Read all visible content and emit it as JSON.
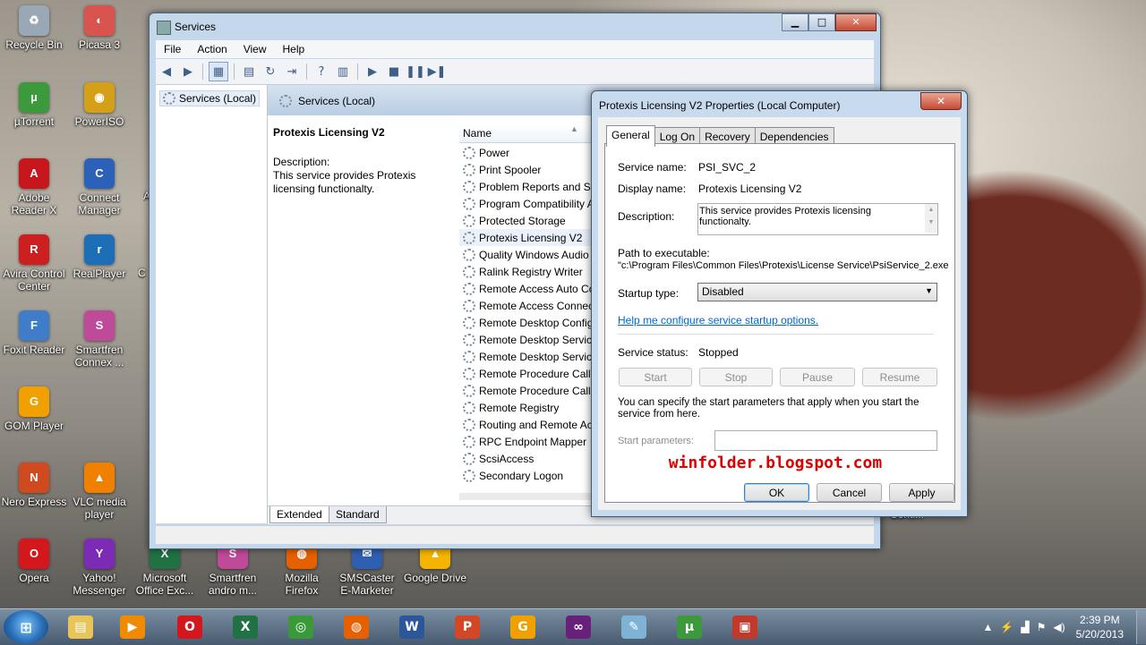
{
  "desktop": {
    "icons": [
      {
        "label": "Recycle Bin",
        "icon": "recycle-bin-icon",
        "color": "#9aa7b5",
        "glyph": "♻"
      },
      {
        "label": "Picasa 3",
        "icon": "picasa-icon",
        "color": "#d9534f",
        "glyph": "◐"
      },
      {
        "label": "µTorrent",
        "icon": "utorrent-icon",
        "color": "#3c9a3c",
        "glyph": "µ"
      },
      {
        "label": "PowerISO",
        "icon": "poweriso-icon",
        "color": "#d4a017",
        "glyph": "◉"
      },
      {
        "label": "Adobe Reader X",
        "icon": "adobe-reader-icon",
        "color": "#c8161d",
        "glyph": "A"
      },
      {
        "label": "Connect Manager",
        "icon": "connect-manager-icon",
        "color": "#2b61b8",
        "glyph": "C"
      },
      {
        "label": "Avira Control Center",
        "icon": "avira-icon",
        "color": "#cc1f1f",
        "glyph": "R"
      },
      {
        "label": "RealPlayer",
        "icon": "realplayer-icon",
        "color": "#1c6fb7",
        "glyph": "r"
      },
      {
        "label": "Foxit Reader",
        "icon": "foxit-reader-icon",
        "color": "#3f7dc8",
        "glyph": "F"
      },
      {
        "label": "Smartfren Connex ...",
        "icon": "smartfren-connex-icon",
        "color": "#c04a9a",
        "glyph": "S"
      },
      {
        "label": "GOM Player",
        "icon": "gom-player-icon",
        "color": "#f0a000",
        "glyph": "G"
      },
      {
        "label": "Nero Express",
        "icon": "nero-express-icon",
        "color": "#d04a20",
        "glyph": "N"
      },
      {
        "label": "VLC media player",
        "icon": "vlc-icon",
        "color": "#f08000",
        "glyph": "▲"
      },
      {
        "label": "Opera",
        "icon": "opera-icon",
        "color": "#d4161d",
        "glyph": "O"
      },
      {
        "label": "Yahoo! Messenger",
        "icon": "yahoo-messenger-icon",
        "color": "#7b2bb5",
        "glyph": "Y"
      },
      {
        "label": "Microsoft Office Exc...",
        "icon": "excel-shortcut-icon",
        "color": "#207245",
        "glyph": "X"
      },
      {
        "label": "Smartfren andro m...",
        "icon": "smartfren-andro-icon",
        "color": "#c04a9a",
        "glyph": "S"
      },
      {
        "label": "Mozilla Firefox",
        "icon": "firefox-icon",
        "color": "#e66000",
        "glyph": "◍"
      },
      {
        "label": "SMSCaster E-Marketer",
        "icon": "smscaster-icon",
        "color": "#2f5fb0",
        "glyph": "✉"
      },
      {
        "label": "Google Drive",
        "icon": "google-drive-icon",
        "color": "#f4b400",
        "glyph": "▲"
      }
    ],
    "partial_labels": [
      "C",
      "A",
      "Conti..."
    ]
  },
  "services_window": {
    "title": "Services",
    "menu": [
      "File",
      "Action",
      "View",
      "Help"
    ],
    "tree_item": "Services (Local)",
    "header_label": "Services (Local)",
    "selected_service_title": "Protexis Licensing V2",
    "description_label": "Description:",
    "description_text": "This service provides Protexis licensing functionalty.",
    "name_column": "Name",
    "services": [
      "Power",
      "Print Spooler",
      "Problem Reports and So",
      "Program Compatibility A",
      "Protected Storage",
      "Protexis Licensing V2",
      "Quality Windows Audio",
      "Ralink Registry Writer",
      "Remote Access Auto Co",
      "Remote Access Connect",
      "Remote Desktop Config",
      "Remote Desktop Service",
      "Remote Desktop Service",
      "Remote Procedure Call",
      "Remote Procedure Call",
      "Remote Registry",
      "Routing and Remote Ac",
      "RPC Endpoint Mapper",
      "ScsiAccess",
      "Secondary Logon"
    ],
    "bottom_tabs": [
      "Extended",
      "Standard"
    ]
  },
  "properties_dialog": {
    "title": "Protexis Licensing V2 Properties (Local Computer)",
    "tabs": [
      "General",
      "Log On",
      "Recovery",
      "Dependencies"
    ],
    "service_name_label": "Service name:",
    "service_name": "PSI_SVC_2",
    "display_name_label": "Display name:",
    "display_name": "Protexis Licensing V2",
    "description_label": "Description:",
    "description": "This service provides Protexis licensing functionalty.",
    "path_label": "Path to executable:",
    "path": "\"c:\\Program Files\\Common Files\\Protexis\\License Service\\PsiService_2.exe",
    "startup_type_label": "Startup type:",
    "startup_type": "Disabled",
    "help_link": "Help me configure service startup options.",
    "service_status_label": "Service status:",
    "service_status": "Stopped",
    "buttons": {
      "start": "Start",
      "stop": "Stop",
      "pause": "Pause",
      "resume": "Resume"
    },
    "params_note": "You can specify the start parameters that apply when you start the service from here.",
    "start_params_label": "Start parameters:",
    "start_params_value": "",
    "ok": "OK",
    "cancel": "Cancel",
    "apply": "Apply"
  },
  "watermark": "winfolder.blogspot.com",
  "taskbar": {
    "apps": [
      {
        "name": "explorer",
        "icon": "file-explorer-icon",
        "color": "#e8c45a",
        "glyph": "▤"
      },
      {
        "name": "media player",
        "icon": "media-player-icon",
        "color": "#f08a00",
        "glyph": "▶"
      },
      {
        "name": "opera",
        "icon": "opera-icon",
        "color": "#d4161d",
        "glyph": "O"
      },
      {
        "name": "excel",
        "icon": "excel-icon",
        "color": "#207245",
        "glyph": "X"
      },
      {
        "name": "chrome",
        "icon": "chrome-icon",
        "color": "#3a9a3a",
        "glyph": "◎"
      },
      {
        "name": "firefox",
        "icon": "firefox-icon",
        "color": "#e66000",
        "glyph": "◍"
      },
      {
        "name": "word",
        "icon": "word-icon",
        "color": "#2b579a",
        "glyph": "W"
      },
      {
        "name": "powerpoint",
        "icon": "powerpoint-icon",
        "color": "#d24726",
        "glyph": "P"
      },
      {
        "name": "gom player",
        "icon": "gom-player-icon",
        "color": "#f0a000",
        "glyph": "G"
      },
      {
        "name": "visual studio",
        "icon": "visual-studio-icon",
        "color": "#68217a",
        "glyph": "∞"
      },
      {
        "name": "notepad",
        "icon": "notepad-icon",
        "color": "#7fb3d5",
        "glyph": "✎"
      },
      {
        "name": "utorrent",
        "icon": "utorrent-icon",
        "color": "#3c9a3c",
        "glyph": "µ"
      },
      {
        "name": "toolbox",
        "icon": "toolbox-icon",
        "color": "#c0392b",
        "glyph": "▣"
      }
    ],
    "time": "2:39 PM",
    "date": "5/20/2013"
  }
}
